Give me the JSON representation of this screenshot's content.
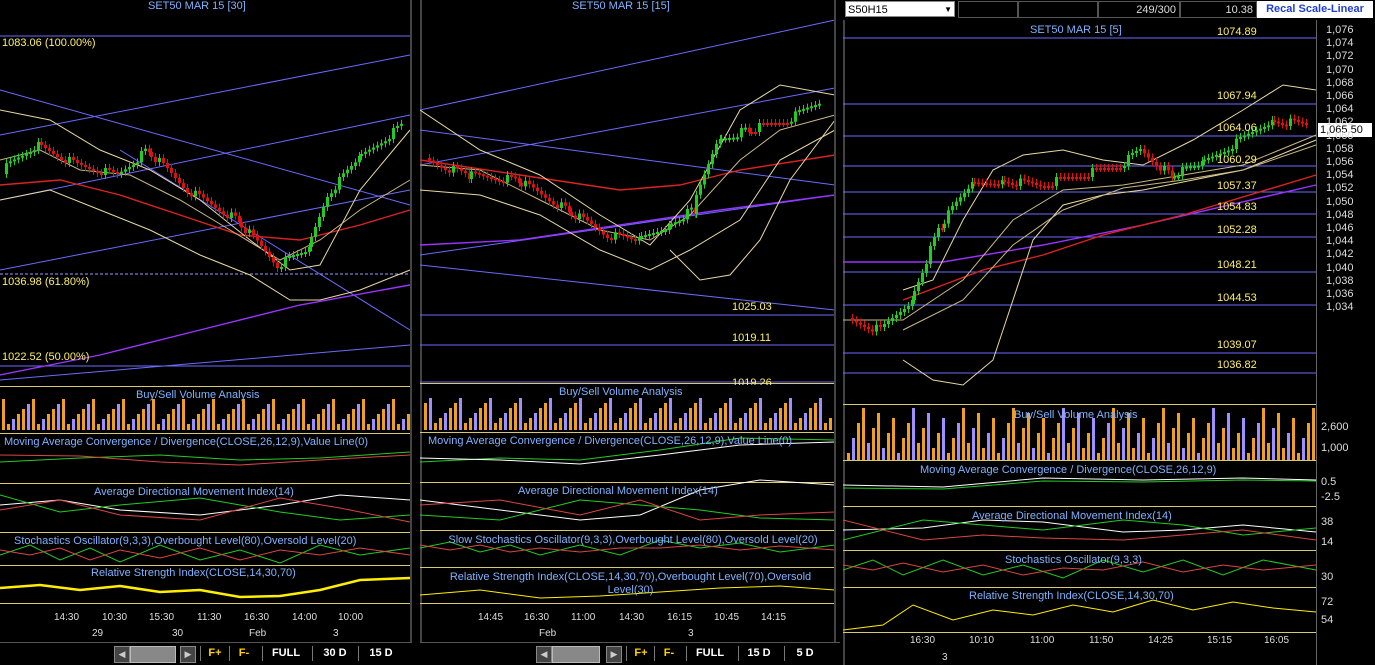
{
  "colors": {
    "background": "#000000",
    "candle_up": "#22cc22",
    "candle_down": "#dd1111",
    "accent": "#7fb2ff",
    "level": "#ffef6b",
    "divider": "#d9c96a"
  },
  "panels": [
    {
      "title": "SET50 MAR 15  [30]",
      "levels": [
        "1083.06 (100.00%)",
        "1036.98 (61.80%)",
        "1022.52 (50.00%)"
      ],
      "indicators": {
        "volume": "Buy/Sell Volume Analysis",
        "macd": "Moving Average Convergence / Divergence(CLOSE,26,12,9),Value Line(0)",
        "adx": "Average Directional Movement Index(14)",
        "stoch": "Stochastics Oscillator(9,3,3),Overbought Level(80),Oversold Level(20)",
        "rsi": "Relative Strength Index(CLOSE,14,30,70)"
      },
      "time_ticks": [
        "14:30",
        "10:30",
        "15:30",
        "11:30",
        "16:30",
        "14:00",
        "10:00"
      ],
      "date_ticks": [
        "29",
        "30",
        "Feb",
        "3"
      ],
      "buttons": {
        "f_plus": "F+",
        "f_minus": "F-",
        "full": "FULL",
        "range1": "30 D",
        "range2": "15 D"
      }
    },
    {
      "title": "SET50 MAR 15   [15]",
      "levels": [
        "1025.03",
        "1019.11",
        "1019.26"
      ],
      "indicators": {
        "volume": "Buy/Sell Volume Analysis",
        "macd": "Moving Average Convergence / Divergence(CLOSE,26,12,9),Value Line(0)",
        "adx": "Average Directional Movement Index(14)",
        "stoch": "Slow Stochastics Oscillator(9,3,3),Overbought Level(80),Oversold Level(20)",
        "rsi": "Relative Strength Index(CLOSE,14,30,70),Overbought Level(70),Oversold Level(30)"
      },
      "time_ticks": [
        "14:45",
        "16:30",
        "11:00",
        "14:30",
        "16:15",
        "10:45",
        "14:15"
      ],
      "date_ticks": [
        "Feb",
        "3"
      ],
      "buttons": {
        "f_plus": "F+",
        "f_minus": "F-",
        "full": "FULL",
        "range1": "15 D",
        "range2": "5 D"
      }
    },
    {
      "title": "SET50 MAR 15   [5]",
      "header": {
        "symbol": "S50H15",
        "counter": "249/300",
        "value": "10.38",
        "scale_button": "Recal Scale-Linear"
      },
      "last_price": "1,065.50",
      "levels": [
        "1074.89",
        "1067.94",
        "1064.06",
        "1060.29",
        "1057.37",
        "1054.83",
        "1052.28",
        "1048.21",
        "1044.53",
        "1039.07",
        "1036.82"
      ],
      "y_axis": [
        "1,076",
        "1,074",
        "1,072",
        "1,070",
        "1,068",
        "1,066",
        "1,064",
        "1,062",
        "1,060",
        "1,058",
        "1,056",
        "1,054",
        "1,052",
        "1,050",
        "1,048",
        "1,046",
        "1,044",
        "1,042",
        "1,040",
        "1,038",
        "1,036",
        "1,034"
      ],
      "ind_axis": {
        "volume": [
          "2,600",
          "1,000"
        ],
        "macd": [
          "0.5",
          "-2.5"
        ],
        "adx": [
          "38",
          "14"
        ],
        "stoch": [
          "30"
        ],
        "rsi": [
          "72",
          "54"
        ]
      },
      "indicators": {
        "volume": "Buy/Sell Volume Analysis",
        "macd": "Moving Average Convergence / Divergence(CLOSE,26,12,9)",
        "adx": "Average Directional Movement Index(14)",
        "stoch": "Stochastics Oscillator(9,3,3)",
        "rsi": "Relative Strength Index(CLOSE,14,30,70)"
      },
      "time_ticks": [
        "16:30",
        "10:10",
        "11:00",
        "11:50",
        "14:25",
        "15:15",
        "16:05"
      ],
      "date_ticks": [
        "3"
      ]
    }
  ]
}
